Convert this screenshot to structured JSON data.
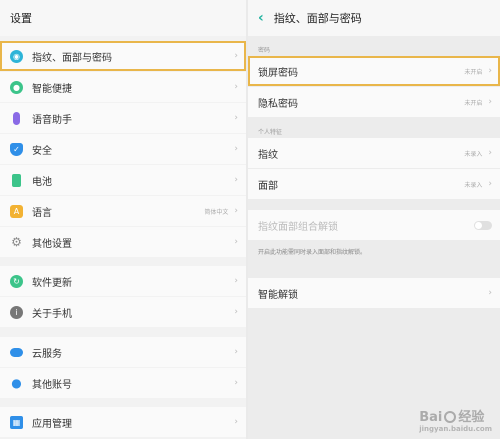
{
  "left": {
    "title": "设置",
    "items": [
      {
        "label": "指纹、面部与密码",
        "value": "",
        "icon": "fingerprint-icon",
        "color": "#2db4d8"
      },
      {
        "label": "智能便捷",
        "value": "",
        "icon": "smart-icon",
        "color": "#3cc48a"
      },
      {
        "label": "语音助手",
        "value": "",
        "icon": "microphone-icon",
        "color": "#8a6ae6"
      },
      {
        "label": "安全",
        "value": "",
        "icon": "shield-icon",
        "color": "#2f8fe8"
      },
      {
        "label": "电池",
        "value": "",
        "icon": "battery-icon",
        "color": "#3cc48a"
      },
      {
        "label": "语言",
        "value": "简体中文",
        "icon": "language-icon",
        "color": "#f2b233"
      },
      {
        "label": "其他设置",
        "value": "",
        "icon": "gear-icon",
        "color": "#888888"
      },
      {
        "label": "软件更新",
        "value": "",
        "icon": "update-icon",
        "color": "#3cc48a"
      },
      {
        "label": "关于手机",
        "value": "",
        "icon": "info-icon",
        "color": "#777777"
      },
      {
        "label": "云服务",
        "value": "",
        "icon": "cloud-icon",
        "color": "#2f8fe8"
      },
      {
        "label": "其他账号",
        "value": "",
        "icon": "account-icon",
        "color": "#2f8fe8"
      },
      {
        "label": "应用管理",
        "value": "",
        "icon": "apps-icon",
        "color": "#2f8fe8"
      }
    ]
  },
  "right": {
    "title": "指纹、面部与密码",
    "section1": "密码",
    "lock_password": {
      "label": "锁屏密码",
      "value": "未开启"
    },
    "privacy_password": {
      "label": "隐私密码",
      "value": "未开启"
    },
    "section2": "个人特征",
    "fingerprint": {
      "label": "指纹",
      "value": "未录入"
    },
    "face": {
      "label": "面部",
      "value": "未录入"
    },
    "combo_unlock": {
      "label": "指纹面部组合解锁"
    },
    "combo_note": "开启此功能需同时录入面部和指纹解锁。",
    "smart_unlock": {
      "label": "智能解锁"
    }
  },
  "watermark": {
    "text1": "Bai",
    "text2": "经验",
    "sub": "jingyan.baidu.com"
  }
}
